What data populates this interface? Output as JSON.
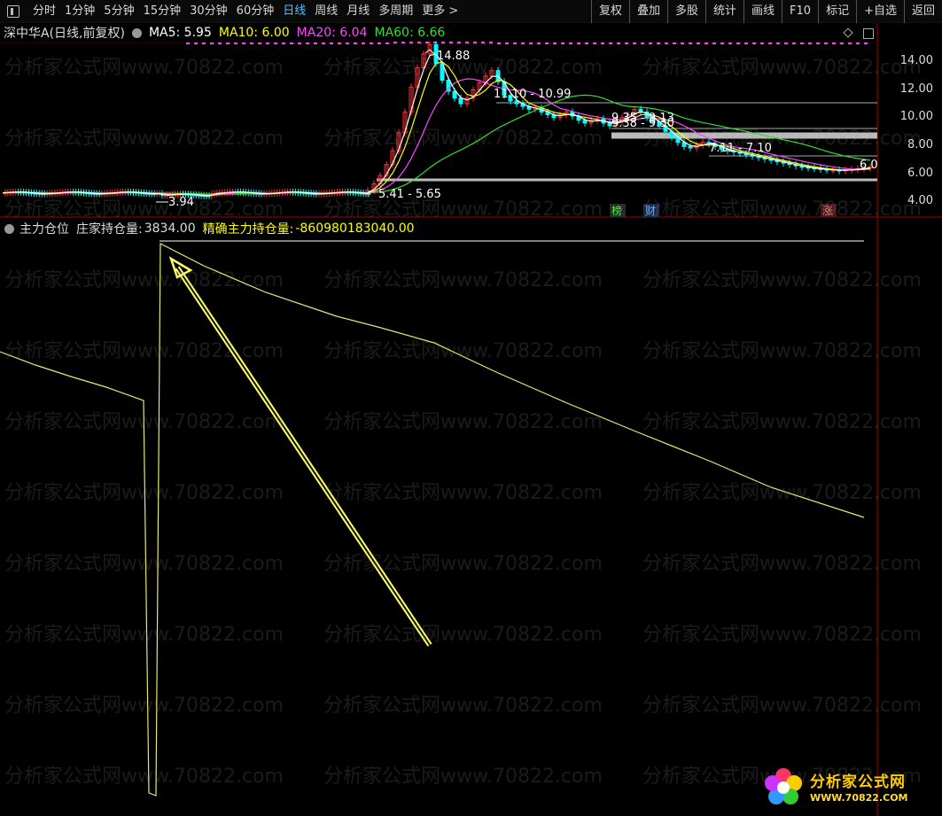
{
  "toolbar": {
    "items": [
      "分时",
      "1分钟",
      "5分钟",
      "15分钟",
      "30分钟",
      "60分钟",
      "日线",
      "周线",
      "月线",
      "多周期",
      "更多 >"
    ],
    "active_index": 6,
    "right_items": [
      "复权",
      "叠加",
      "多股",
      "统计",
      "画线",
      "F10",
      "标记",
      "+自选",
      "返回"
    ]
  },
  "price_panel": {
    "stock_label": "深中华A(日线,前复权)",
    "ma5": "MA5: 5.95",
    "ma10": "MA10: 6.00",
    "ma20": "MA20: 6.04",
    "ma60": "MA60: 6.66",
    "colors": {
      "ma5": "#ffffff",
      "ma10": "#ffff00",
      "ma20": "#ff44ff",
      "ma60": "#33dd33",
      "candle_up": "#ff3333",
      "candle_down": "#00ffff"
    },
    "y_labels": [
      "14.00",
      "12.00",
      "10.00",
      "8.00",
      "6.00",
      "4.00"
    ],
    "annotations": {
      "high": "14.88",
      "low": "3.94",
      "range1": "5.41 - 5.65",
      "range2": "11.10 - 10.99",
      "range3": "9.35 - 9.13",
      "range4": "9.38 - 9.30",
      "range5": "7.11 - 7.10",
      "last": "6.0"
    },
    "badges": {
      "b1": "榜",
      "b2": "财",
      "b3": "涨"
    }
  },
  "indicator_panel": {
    "title": "主力仓位",
    "item1_label": "庄家持仓量:",
    "item1_value": "3834.00",
    "item2_label": "精确主力持仓量:",
    "item2_value": "-860980183040.00",
    "colors": {
      "title": "#dddddd",
      "item1": "#dddddd",
      "item2": "#ffff00",
      "line": "#e8e870"
    }
  },
  "watermark": "分析家公式网www.70822.com",
  "logo": {
    "title": "分析家公式网",
    "url": "WWW.70822.COM"
  }
}
